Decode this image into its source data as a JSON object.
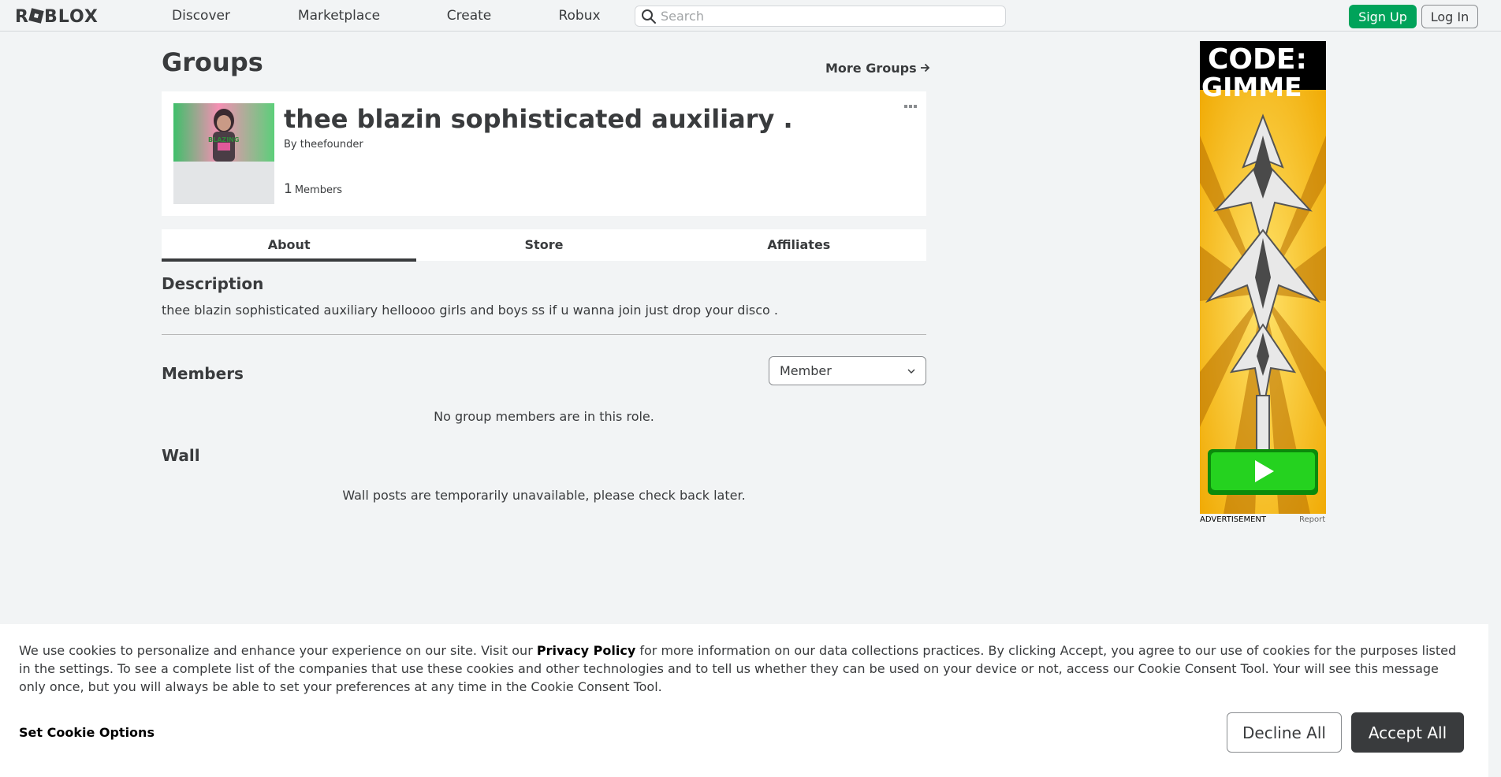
{
  "header": {
    "logo_text": "ROBLOX",
    "nav": [
      {
        "label": "Discover"
      },
      {
        "label": "Marketplace"
      },
      {
        "label": "Create"
      },
      {
        "label": "Robux"
      }
    ],
    "search_placeholder": "Search",
    "signup_label": "Sign Up",
    "login_label": "Log In"
  },
  "page": {
    "title": "Groups",
    "more_groups": "More Groups"
  },
  "group": {
    "name": "thee blazin sophisticated auxiliary .",
    "owner_prefix": "By",
    "owner": "theefounder",
    "member_count": "1",
    "members_label": "Members",
    "thumbnail_caption": "BLAZING"
  },
  "tabs": [
    {
      "label": "About",
      "active": true
    },
    {
      "label": "Store",
      "active": false
    },
    {
      "label": "Affiliates",
      "active": false
    }
  ],
  "about": {
    "description_title": "Description",
    "description_text": "thee blazin sophisticated auxiliary helloooo girls and boys ss if u wanna join just drop your disco .",
    "members_title": "Members",
    "role_selected": "Member",
    "members_empty": "No group members are in this role.",
    "wall_title": "Wall",
    "wall_empty": "Wall posts are temporarily unavailable, please check back later."
  },
  "ad": {
    "headline_1": "CODE:",
    "headline_2": "GIMME",
    "label": "ADVERTISEMENT",
    "report": "Report"
  },
  "cookie": {
    "text_before": "We use cookies to personalize and enhance your experience on our site. Visit our ",
    "privacy_link": "Privacy Policy",
    "text_after": " for more information on our data collections practices. By clicking Accept, you agree to our use of cookies for the purposes listed in the settings. To see a complete list of the companies that use these cookies and other technologies and to tell us whether they can be used on your device or not, access our Cookie Consent Tool. Your will see this message only once, but you will always be able to set your preferences at any time in the Cookie Consent Tool.",
    "set_options": "Set Cookie Options",
    "decline": "Decline All",
    "accept": "Accept All"
  },
  "colors": {
    "accent_green": "#00a35a",
    "text": "#393b3d",
    "background": "#f2f4f5"
  }
}
